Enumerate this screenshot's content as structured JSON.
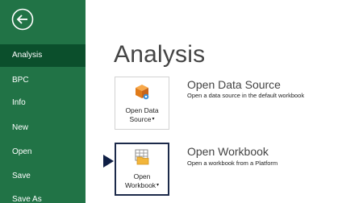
{
  "sidebar": {
    "items": [
      {
        "label": "Analysis"
      },
      {
        "label": "BPC"
      },
      {
        "label": "Info"
      },
      {
        "label": "New"
      },
      {
        "label": "Open"
      },
      {
        "label": "Save"
      },
      {
        "label": "Save As"
      }
    ]
  },
  "main": {
    "title": "Analysis",
    "options": [
      {
        "tile_line1": "Open Data",
        "tile_line2": "Source",
        "title": "Open Data Source",
        "description": "Open a data source in the default workbook"
      },
      {
        "tile_line1": "Open",
        "tile_line2": "Workbook",
        "title": "Open Workbook",
        "description": "Open a workbook from a Platform"
      }
    ]
  },
  "colors": {
    "sidebar_bg": "#217346",
    "sidebar_active": "#0b4f2c",
    "selection_border": "#1c2a4a"
  }
}
